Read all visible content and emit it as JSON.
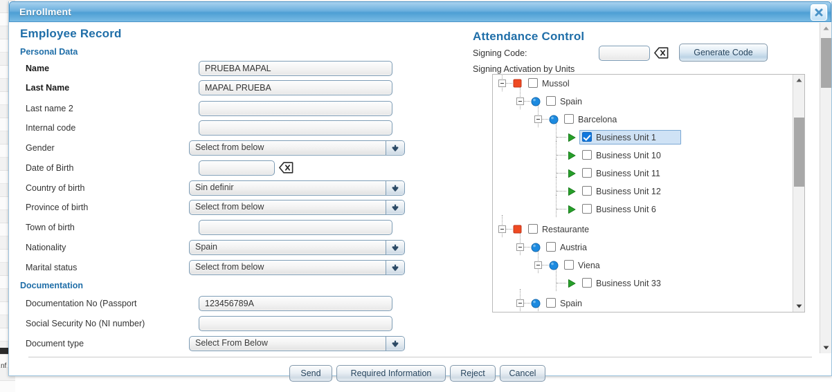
{
  "window": {
    "title": "Enrollment",
    "close_icon": "close-icon"
  },
  "left_panel": {
    "heading": "Employee Record",
    "sections": [
      {
        "heading": "Personal Data"
      },
      {
        "heading": "Documentation"
      }
    ],
    "personal_data_heading": "Personal Data",
    "documentation_heading": "Documentation",
    "fields": [
      {
        "label": "Name",
        "type": "text",
        "value": "PRUEBA MAPAL",
        "bold": true
      },
      {
        "label": "Last Name",
        "type": "text",
        "value": "MAPAL PRUEBA",
        "bold": true
      },
      {
        "label": "Last name 2",
        "type": "text",
        "value": "",
        "bold": false
      },
      {
        "label": "Internal code",
        "type": "text",
        "value": "",
        "bold": false
      },
      {
        "label": "Gender",
        "type": "select",
        "value": "Select from below",
        "bold": false
      },
      {
        "label": "Date of Birth",
        "type": "date",
        "value": "",
        "bold": false
      },
      {
        "label": "Country of birth",
        "type": "select",
        "value": "Sin definir",
        "bold": false
      },
      {
        "label": "Province of birth",
        "type": "select",
        "value": "Select from below",
        "bold": false
      },
      {
        "label": "Town of birth",
        "type": "text",
        "value": "",
        "bold": false
      },
      {
        "label": "Nationality",
        "type": "select",
        "value": "Spain",
        "bold": false
      },
      {
        "label": "Marital status",
        "type": "select",
        "value": "Select from below",
        "bold": false
      },
      {
        "label": "Documentation No (Passport",
        "type": "text",
        "value": "123456789A",
        "bold": false
      },
      {
        "label": "Social Security No (NI number)",
        "type": "text",
        "value": "",
        "bold": false
      },
      {
        "label": "Document type",
        "type": "select",
        "value": "Select From Below",
        "bold": false
      }
    ]
  },
  "right_panel": {
    "heading": "Attendance Control",
    "signing_code_label": "Signing Code:",
    "signing_code_value": "",
    "clear_icon": "backspace-clear-icon",
    "generate_button": "Generate Code",
    "units_label": "Signing Activation by Units",
    "tree": [
      {
        "label": "Mussol",
        "depth": 0,
        "icon": "red-square-icon",
        "expander": true,
        "checked": false,
        "selected": false
      },
      {
        "label": "Spain",
        "depth": 1,
        "icon": "blue-circle-icon",
        "expander": true,
        "checked": false,
        "selected": false
      },
      {
        "label": "Barcelona",
        "depth": 2,
        "icon": "blue-circle-icon",
        "expander": true,
        "checked": false,
        "selected": false
      },
      {
        "label": "Business Unit 1",
        "depth": 3,
        "icon": "green-arrow-icon",
        "expander": false,
        "checked": true,
        "selected": true
      },
      {
        "label": "Business Unit 10",
        "depth": 3,
        "icon": "green-arrow-icon",
        "expander": false,
        "checked": false,
        "selected": false
      },
      {
        "label": "Business Unit 11",
        "depth": 3,
        "icon": "green-arrow-icon",
        "expander": false,
        "checked": false,
        "selected": false
      },
      {
        "label": "Business Unit 12",
        "depth": 3,
        "icon": "green-arrow-icon",
        "expander": false,
        "checked": false,
        "selected": false
      },
      {
        "label": "Business Unit 6",
        "depth": 3,
        "icon": "green-arrow-icon",
        "expander": false,
        "checked": false,
        "selected": false
      },
      {
        "label": "Restaurante",
        "depth": 0,
        "icon": "red-square-icon",
        "expander": true,
        "checked": false,
        "selected": false
      },
      {
        "label": "Austria",
        "depth": 1,
        "icon": "blue-circle-icon",
        "expander": true,
        "checked": false,
        "selected": false
      },
      {
        "label": "Viena",
        "depth": 2,
        "icon": "blue-circle-icon",
        "expander": true,
        "checked": false,
        "selected": false
      },
      {
        "label": "Business Unit 33",
        "depth": 3,
        "icon": "green-arrow-icon",
        "expander": false,
        "checked": false,
        "selected": false
      },
      {
        "label": "Spain",
        "depth": 1,
        "icon": "blue-circle-icon",
        "expander": true,
        "checked": false,
        "selected": false
      },
      {
        "label": "",
        "depth": 2,
        "icon": "blue-circle-icon",
        "expander": true,
        "checked": false,
        "selected": false
      }
    ]
  },
  "footer": {
    "buttons": [
      {
        "label": "Send"
      },
      {
        "label": "Required Information"
      },
      {
        "label": "Reject"
      },
      {
        "label": "Cancel"
      }
    ]
  },
  "background": {
    "text_fragment": "nf"
  },
  "colors": {
    "accent_blue": "#1f6ea8",
    "title_blue": "#4e9fd4",
    "selection_blue": "#cfe2f5",
    "checkbox_blue": "#1177dd",
    "node_red": "#ef4a22",
    "node_blue": "#1c8ae0",
    "node_green": "#27a02a"
  }
}
